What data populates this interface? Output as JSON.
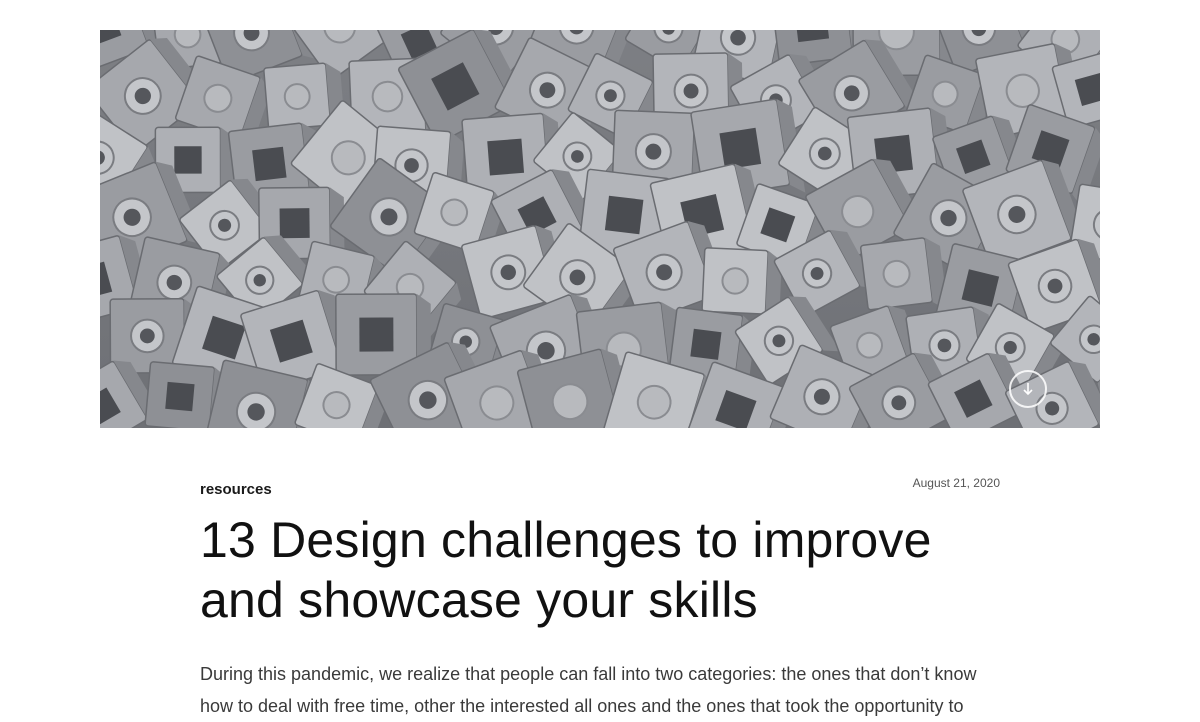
{
  "hero": {
    "image_subject": "pile of grey 1x1 toy bricks with side studs",
    "scroll_icon": "arrow-down-icon"
  },
  "article": {
    "category": "resources",
    "date": "August 21, 2020",
    "title": "13 Design challenges to improve and showcase your skills",
    "intro": "During this pandemic, we realize that people can fall into two categories: the ones that don’t know how to deal with free time, other the interested all ones and the ones that took the opportunity to"
  },
  "colors": {
    "background": "#ffffff",
    "text_primary": "#111111",
    "text_secondary": "#3a3a3a",
    "brick_grey": "#a4a6ab"
  }
}
